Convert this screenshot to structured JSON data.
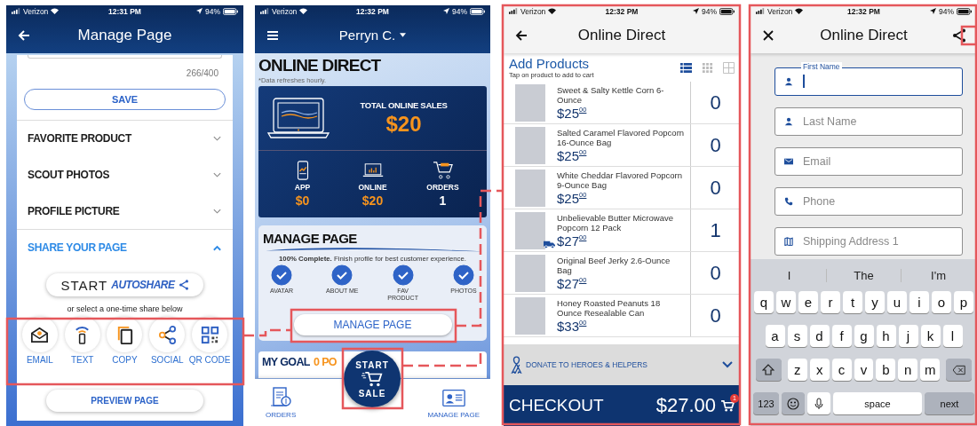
{
  "manage_screen": {
    "status_bar": {
      "carrier": "Verizon",
      "time": "12:31 PM",
      "battery": "94%"
    },
    "title": "Manage Page",
    "char_count": "266/400",
    "save_button": "SAVE",
    "sections": [
      {
        "label": "FAVORITE PRODUCT",
        "expanded": false
      },
      {
        "label": "SCOUT PHOTOS",
        "expanded": false
      },
      {
        "label": "PROFILE PICTURE",
        "expanded": false
      },
      {
        "label": "SHARE YOUR PAGE",
        "expanded": true
      }
    ],
    "autoshare_button": {
      "start": "START",
      "brand": "AUTOSHARE"
    },
    "share_hint": "or select a one-time share below",
    "share_options": [
      {
        "kind": "email",
        "label": "EMAIL"
      },
      {
        "kind": "text",
        "label": "TEXT"
      },
      {
        "kind": "copy",
        "label": "COPY"
      },
      {
        "kind": "social",
        "label": "SOCIAL"
      },
      {
        "kind": "qr",
        "label": "QR CODE"
      }
    ],
    "preview_button": "PREVIEW PAGE"
  },
  "dashboard_screen": {
    "status_bar": {
      "carrier": "Verizon",
      "time": "12:32 PM",
      "battery": "94%"
    },
    "user": "Perryn C.",
    "heading": "ONLINE DIRECT",
    "note": "*Data refreshes hourly.",
    "total_label": "TOTAL ONLINE SALES",
    "total_value": "$20",
    "stats": [
      {
        "kind": "app",
        "label": "APP",
        "value": "$0",
        "color": "#f7941d"
      },
      {
        "kind": "online",
        "label": "ONLINE",
        "value": "$20",
        "color": "#f7941d"
      },
      {
        "kind": "orders",
        "label": "ORDERS",
        "value": "1",
        "color": "#ffffff"
      }
    ],
    "manage": {
      "title": "MANAGE PAGE",
      "progress": "**100% Complete.** Finish profile for best customer experience.",
      "steps": [
        {
          "label": "AVATAR",
          "checked": true
        },
        {
          "label": "ABOUT ME",
          "checked": true
        },
        {
          "label": "FAV PRODUCT",
          "checked": true
        },
        {
          "label": "PHOTOS",
          "checked": true
        }
      ],
      "button": "MANAGE PAGE"
    },
    "goal": {
      "label": "MY GOAL",
      "value": "0 PO"
    },
    "nav": [
      {
        "kind": "orders",
        "label": "ORDERS"
      },
      {
        "kind": "profile",
        "label": "MANAGE PAGE"
      }
    ],
    "start_sale": {
      "top": "START",
      "bottom": "SALE"
    }
  },
  "product_screen": {
    "status_bar": {
      "carrier": "Verizon",
      "time": "12:32 PM",
      "battery": "94%"
    },
    "title": "Online Direct",
    "heading": "Add Products",
    "subheading": "Tap on product to add to cart",
    "views": [
      {
        "kind": "list",
        "selected": true
      },
      {
        "kind": "dots",
        "selected": false
      },
      {
        "kind": "grid",
        "selected": false
      }
    ],
    "products": [
      {
        "name": "Sweet & Salty Kettle Corn 6-Ounce",
        "price": "$25",
        "cents": "00",
        "quantity": "0",
        "shipping": false
      },
      {
        "name": "Salted Caramel Flavored Popcorn 16-Ounce Bag",
        "price": "$25",
        "cents": "00",
        "quantity": "0",
        "shipping": false
      },
      {
        "name": "White Cheddar Flavored Popcorn 9-Ounce Bag",
        "price": "$25",
        "cents": "00",
        "quantity": "0",
        "shipping": false
      },
      {
        "name": "Unbelievable Butter Microwave Popcorn 12 Pack",
        "price": "$27",
        "cents": "00",
        "quantity": "1",
        "shipping": true
      },
      {
        "name": "Original Beef Jerky 2.6-Ounce Bag",
        "price": "$27",
        "cents": "00",
        "quantity": "0",
        "shipping": false
      },
      {
        "name": "Honey Roasted Peanuts 18 Ounce Resealable Can",
        "price": "$33",
        "cents": "00",
        "quantity": "0",
        "shipping": false
      }
    ],
    "donate": "DONATE TO HEROES & HELPERS",
    "checkout": {
      "label": "CHECKOUT",
      "total": "$27.00",
      "badge": "1"
    }
  },
  "form_screen": {
    "status_bar": {
      "carrier": "Verizon",
      "time": "12:32 PM",
      "battery": "94%"
    },
    "title": "Online Direct",
    "fields": [
      {
        "kind": "person",
        "placeholder": "First Name",
        "focused": true
      },
      {
        "kind": "person",
        "placeholder": "Last Name",
        "focused": false
      },
      {
        "kind": "email",
        "placeholder": "Email",
        "focused": false
      },
      {
        "kind": "phone",
        "placeholder": "Phone",
        "focused": false
      },
      {
        "kind": "map",
        "placeholder": "Shipping Address 1",
        "focused": false
      }
    ],
    "keyboard": {
      "suggestions": [
        "I",
        "The",
        "I'm"
      ],
      "rows": [
        [
          "q",
          "w",
          "e",
          "r",
          "t",
          "y",
          "u",
          "i",
          "o",
          "p"
        ],
        [
          "a",
          "s",
          "d",
          "f",
          "g",
          "h",
          "j",
          "k",
          "l"
        ],
        [
          "z",
          "x",
          "c",
          "v",
          "b",
          "n",
          "m"
        ]
      ],
      "numbers_key": "123",
      "space_key": "space",
      "action_key": "next"
    }
  }
}
